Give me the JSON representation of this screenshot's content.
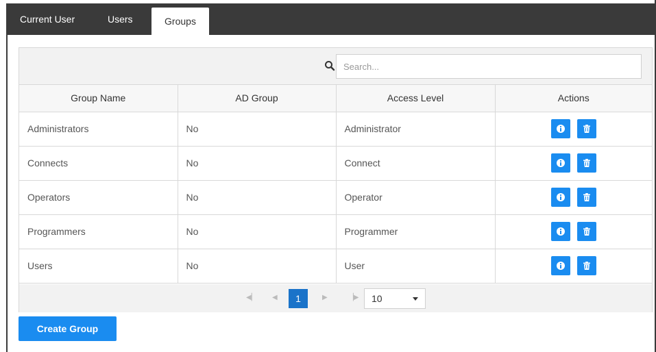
{
  "tabs": [
    {
      "label": "Current User"
    },
    {
      "label": "Users"
    },
    {
      "label": "Groups"
    }
  ],
  "search": {
    "placeholder": "Search..."
  },
  "table": {
    "headers": [
      "Group Name",
      "AD Group",
      "Access Level",
      "Actions"
    ],
    "rows": [
      {
        "name": "Administrators",
        "ad": "No",
        "level": "Administrator"
      },
      {
        "name": "Connects",
        "ad": "No",
        "level": "Connect"
      },
      {
        "name": "Operators",
        "ad": "No",
        "level": "Operator"
      },
      {
        "name": "Programmers",
        "ad": "No",
        "level": "Programmer"
      },
      {
        "name": "Users",
        "ad": "No",
        "level": "User"
      }
    ],
    "action_icons": [
      "info-icon",
      "trash-icon"
    ]
  },
  "pager": {
    "current_page": "1",
    "page_size": "10"
  },
  "create_button": {
    "label": "Create Group"
  },
  "colors": {
    "accent": "#1a8cf0",
    "tabbar": "#3a3a3a",
    "page_active": "#1a73c9"
  }
}
